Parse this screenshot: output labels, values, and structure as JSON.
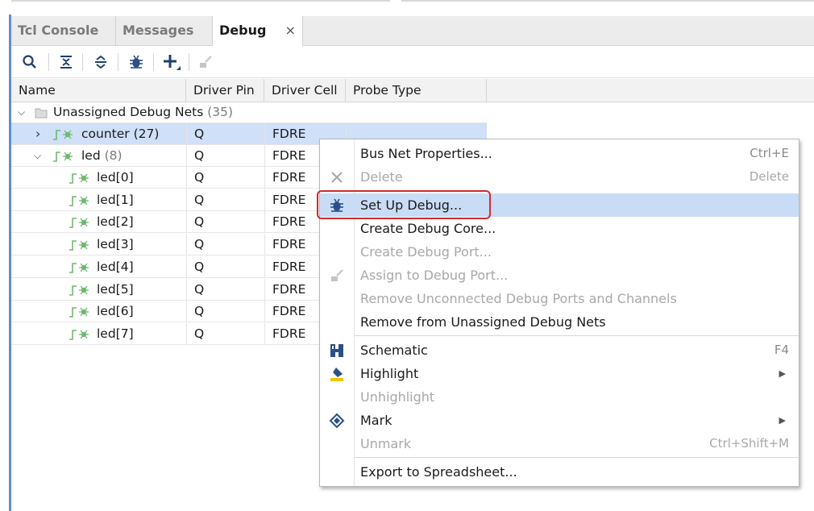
{
  "tabs": [
    {
      "label": "Tcl Console"
    },
    {
      "label": "Messages"
    },
    {
      "label": "Debug",
      "close": "×"
    }
  ],
  "columns": [
    "Name",
    "Driver Pin",
    "Driver Cell",
    "Probe Type"
  ],
  "tree": {
    "root_label": "Unassigned Debug Nets",
    "root_count": "(35)",
    "rows": [
      {
        "name": "counter",
        "count": "(27)",
        "pin": "Q",
        "cell": "FDRE"
      },
      {
        "name": "led",
        "count": "(8)",
        "pin": "Q",
        "cell": "FDRE"
      },
      {
        "name": "led[0]",
        "pin": "Q",
        "cell": "FDRE"
      },
      {
        "name": "led[1]",
        "pin": "Q",
        "cell": "FDRE"
      },
      {
        "name": "led[2]",
        "pin": "Q",
        "cell": "FDRE"
      },
      {
        "name": "led[3]",
        "pin": "Q",
        "cell": "FDRE"
      },
      {
        "name": "led[4]",
        "pin": "Q",
        "cell": "FDRE"
      },
      {
        "name": "led[5]",
        "pin": "Q",
        "cell": "FDRE"
      },
      {
        "name": "led[6]",
        "pin": "Q",
        "cell": "FDRE"
      },
      {
        "name": "led[7]",
        "pin": "Q",
        "cell": "FDRE"
      }
    ]
  },
  "menu": {
    "items": [
      {
        "label": "Bus Net Properties...",
        "shortcut": "Ctrl+E"
      },
      {
        "label": "Delete",
        "shortcut": "Delete"
      },
      {
        "label": "Set Up Debug...",
        "shortcut": ""
      },
      {
        "label": "Create Debug Core...",
        "shortcut": ""
      },
      {
        "label": "Create Debug Port...",
        "shortcut": ""
      },
      {
        "label": "Assign to Debug Port...",
        "shortcut": ""
      },
      {
        "label": "Remove Unconnected Debug Ports and Channels",
        "shortcut": ""
      },
      {
        "label": "Remove from Unassigned Debug Nets",
        "shortcut": ""
      },
      {
        "label": "Schematic",
        "shortcut": "F4"
      },
      {
        "label": "Highlight",
        "shortcut": ""
      },
      {
        "label": "Unhighlight",
        "shortcut": ""
      },
      {
        "label": "Mark",
        "shortcut": ""
      },
      {
        "label": "Unmark",
        "shortcut": "Ctrl+Shift+M"
      },
      {
        "label": "Export to Spreadsheet...",
        "shortcut": ""
      }
    ]
  },
  "colors": {
    "selection": "#cfe0f8",
    "menu_highlight": "#c9dcf6",
    "callout": "#d22b2b",
    "net_icon": "#4caf50",
    "panel_border": "#5b8fd6"
  },
  "icons": [
    "search-icon",
    "collapse-all-icon",
    "expand-all-icon",
    "bug-icon",
    "add-icon",
    "assign-icon",
    "delete-x-icon",
    "schematic-icon",
    "highlight-icon",
    "mark-icon",
    "folder-icon",
    "net-icon"
  ]
}
